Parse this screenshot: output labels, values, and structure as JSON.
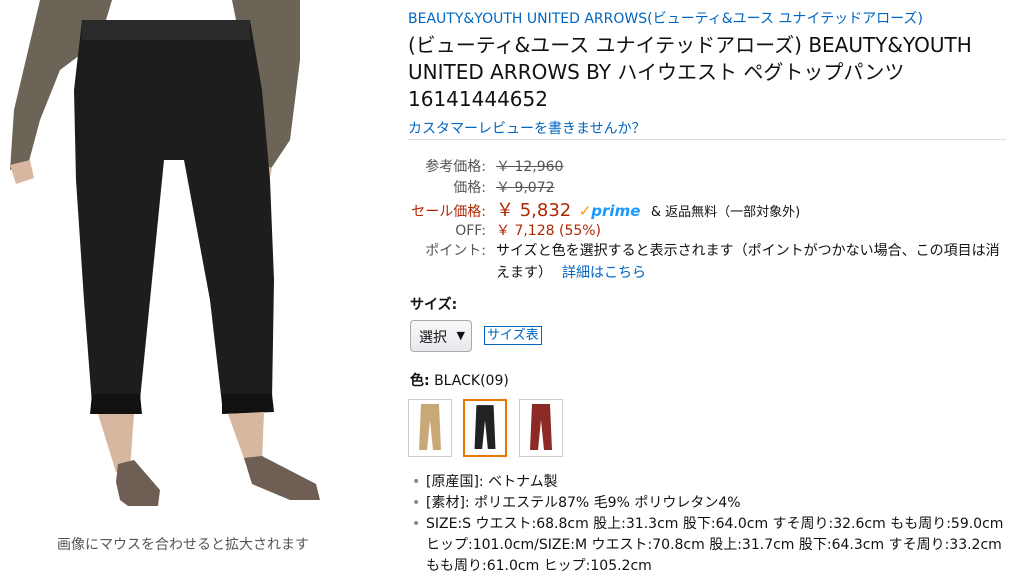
{
  "image_pane": {
    "hover_hint": "画像にマウスを合わせると拡大されます"
  },
  "product": {
    "brand_link": "BEAUTY&YOUTH UNITED ARROWS(ビューティ&ユース ユナイテッドアローズ)",
    "title": "(ビューティ&ユース ユナイテッドアローズ) BEAUTY&YOUTH UNITED ARROWS BY ハイウエスト ペグトップパンツ 16141444652",
    "review_link": "カスタマーレビューを書きませんか？"
  },
  "pricing": {
    "list_label": "参考価格:",
    "list_value": "￥ 12,960",
    "price_label": "価格:",
    "price_value": "￥ 9,072",
    "sale_label": "セール価格:",
    "sale_value": "￥ 5,832",
    "prime_check": "✓",
    "prime_text": "prime",
    "free_return": "& 返品無料（一部対象外)",
    "off_label": "OFF:",
    "off_value": "￥ 7,128 (55%)",
    "points_label": "ポイント:",
    "points_text": "サイズと色を選択すると表示されます（ポイントがつかない場合、この項目は消えます）",
    "points_link": "詳細はこちら"
  },
  "size": {
    "label": "サイズ:",
    "selected": "選択",
    "chart_link": "サイズ表"
  },
  "color": {
    "label": "色:",
    "value": "BLACK(09)",
    "swatches": [
      {
        "name": "beige",
        "color": "#c9a877"
      },
      {
        "name": "black",
        "color": "#222222",
        "selected": true
      },
      {
        "name": "red",
        "color": "#8e2a25"
      }
    ]
  },
  "bullets": [
    "[原産国]: ベトナム製",
    "[素材]: ポリエステル87% 毛9% ポリウレタン4%",
    "SIZE:S ウエスト:68.8cm 股上:31.3cm 股下:64.0cm すそ周り:32.6cm もも周り:59.0cm ヒップ:101.0cm/SIZE:M ウエスト:70.8cm 股上:31.7cm 股下:64.3cm すそ周り:33.2cm もも周り:61.0cm ヒップ:105.2cm"
  ],
  "colors": {
    "link": "#0066c0",
    "sale": "#b12704",
    "prime": "#1a98ff",
    "selected_border": "#e77600"
  }
}
